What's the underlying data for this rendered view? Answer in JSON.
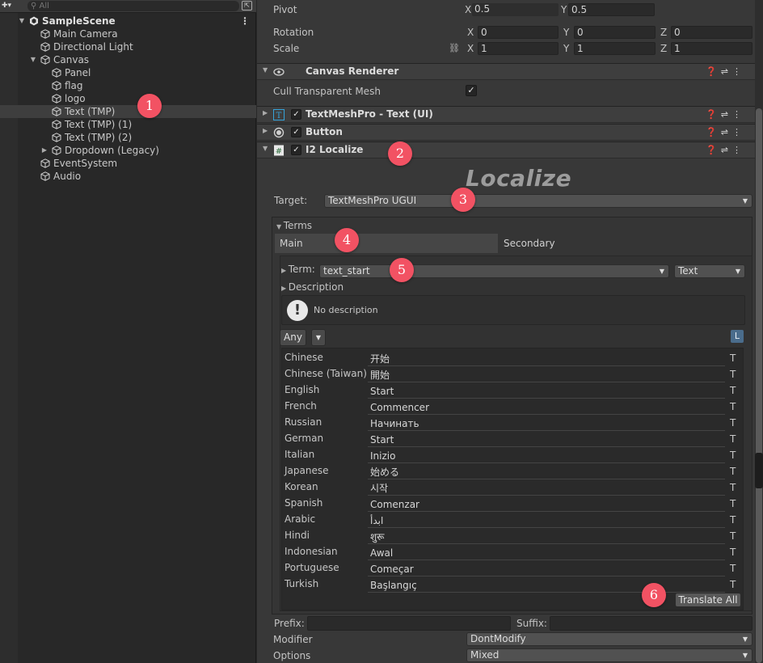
{
  "hierarchy": {
    "search_placeholder": "All",
    "items": [
      {
        "label": "SampleScene",
        "depth": 0,
        "fold": "open",
        "kind": "scene"
      },
      {
        "label": "Main Camera",
        "depth": 1,
        "fold": "none",
        "kind": "object"
      },
      {
        "label": "Directional Light",
        "depth": 1,
        "fold": "none",
        "kind": "object"
      },
      {
        "label": "Canvas",
        "depth": 1,
        "fold": "open",
        "kind": "object"
      },
      {
        "label": "Panel",
        "depth": 2,
        "fold": "none",
        "kind": "object"
      },
      {
        "label": "flag",
        "depth": 2,
        "fold": "none",
        "kind": "object"
      },
      {
        "label": "logo",
        "depth": 2,
        "fold": "none",
        "kind": "object"
      },
      {
        "label": "Text (TMP)",
        "depth": 2,
        "fold": "none",
        "kind": "object",
        "selected": true
      },
      {
        "label": "Text (TMP) (1)",
        "depth": 2,
        "fold": "none",
        "kind": "object"
      },
      {
        "label": "Text (TMP) (2)",
        "depth": 2,
        "fold": "none",
        "kind": "object"
      },
      {
        "label": "Dropdown (Legacy)",
        "depth": 2,
        "fold": "closed",
        "kind": "object"
      },
      {
        "label": "EventSystem",
        "depth": 1,
        "fold": "none",
        "kind": "object"
      },
      {
        "label": "Audio",
        "depth": 1,
        "fold": "none",
        "kind": "object"
      }
    ]
  },
  "transform": {
    "pivot_label": "Pivot",
    "pivot": {
      "x_label": "X",
      "x": "0.5",
      "y_label": "Y",
      "y": "0.5"
    },
    "rotation_label": "Rotation",
    "rotation": {
      "x_label": "X",
      "x": "0",
      "y_label": "Y",
      "y": "0",
      "z_label": "Z",
      "z": "0"
    },
    "scale_label": "Scale",
    "scale": {
      "x_label": "X",
      "x": "1",
      "y_label": "Y",
      "y": "1",
      "z_label": "Z",
      "z": "1"
    }
  },
  "canvas_renderer": {
    "title": "Canvas Renderer",
    "cull_label": "Cull Transparent Mesh",
    "cull_checked": "✓"
  },
  "components": {
    "tmp_title": "TextMeshPro - Text (UI)",
    "button_title": "Button",
    "i2_title": "I2 Localize"
  },
  "i2": {
    "logo_text": "Localize",
    "target_label": "Target:",
    "target_value": "TextMeshPro UGUI",
    "terms_label": "Terms",
    "tab_main": "Main",
    "tab_secondary": "Secondary",
    "term_label": "Term:",
    "term_value": "text_start",
    "term_type": "Text",
    "description_label": "Description",
    "no_description": "No description",
    "filter_any": "Any",
    "l_badge": "L",
    "t_label": "T",
    "translate_all": "Translate All",
    "languages": [
      {
        "name": "Chinese",
        "value": "开始"
      },
      {
        "name": "Chinese (Taiwan)",
        "value": "開始"
      },
      {
        "name": "English",
        "value": "Start"
      },
      {
        "name": "French",
        "value": "Commencer"
      },
      {
        "name": "Russian",
        "value": "Начинать"
      },
      {
        "name": "German",
        "value": "Start"
      },
      {
        "name": "Italian",
        "value": "Inizio"
      },
      {
        "name": "Japanese",
        "value": "始める"
      },
      {
        "name": "Korean",
        "value": "시작"
      },
      {
        "name": "Spanish",
        "value": "Comenzar"
      },
      {
        "name": "Arabic",
        "value": "ابدأ"
      },
      {
        "name": "Hindi",
        "value": "शुरू"
      },
      {
        "name": "Indonesian",
        "value": "Awal"
      },
      {
        "name": "Portuguese",
        "value": "Começar"
      },
      {
        "name": "Turkish",
        "value": "Başlangıç"
      }
    ],
    "prefix_label": "Prefix:",
    "suffix_label": "Suffix:",
    "modifier_label": "Modifier",
    "modifier_value": "DontModify",
    "options_label": "Options",
    "options_value": "Mixed"
  },
  "markers": [
    "1",
    "2",
    "3",
    "4",
    "5",
    "6"
  ],
  "colors": {
    "marker": "#f25263",
    "selection": "#3e3e3e",
    "accent_badge": "#4a6c8c"
  }
}
